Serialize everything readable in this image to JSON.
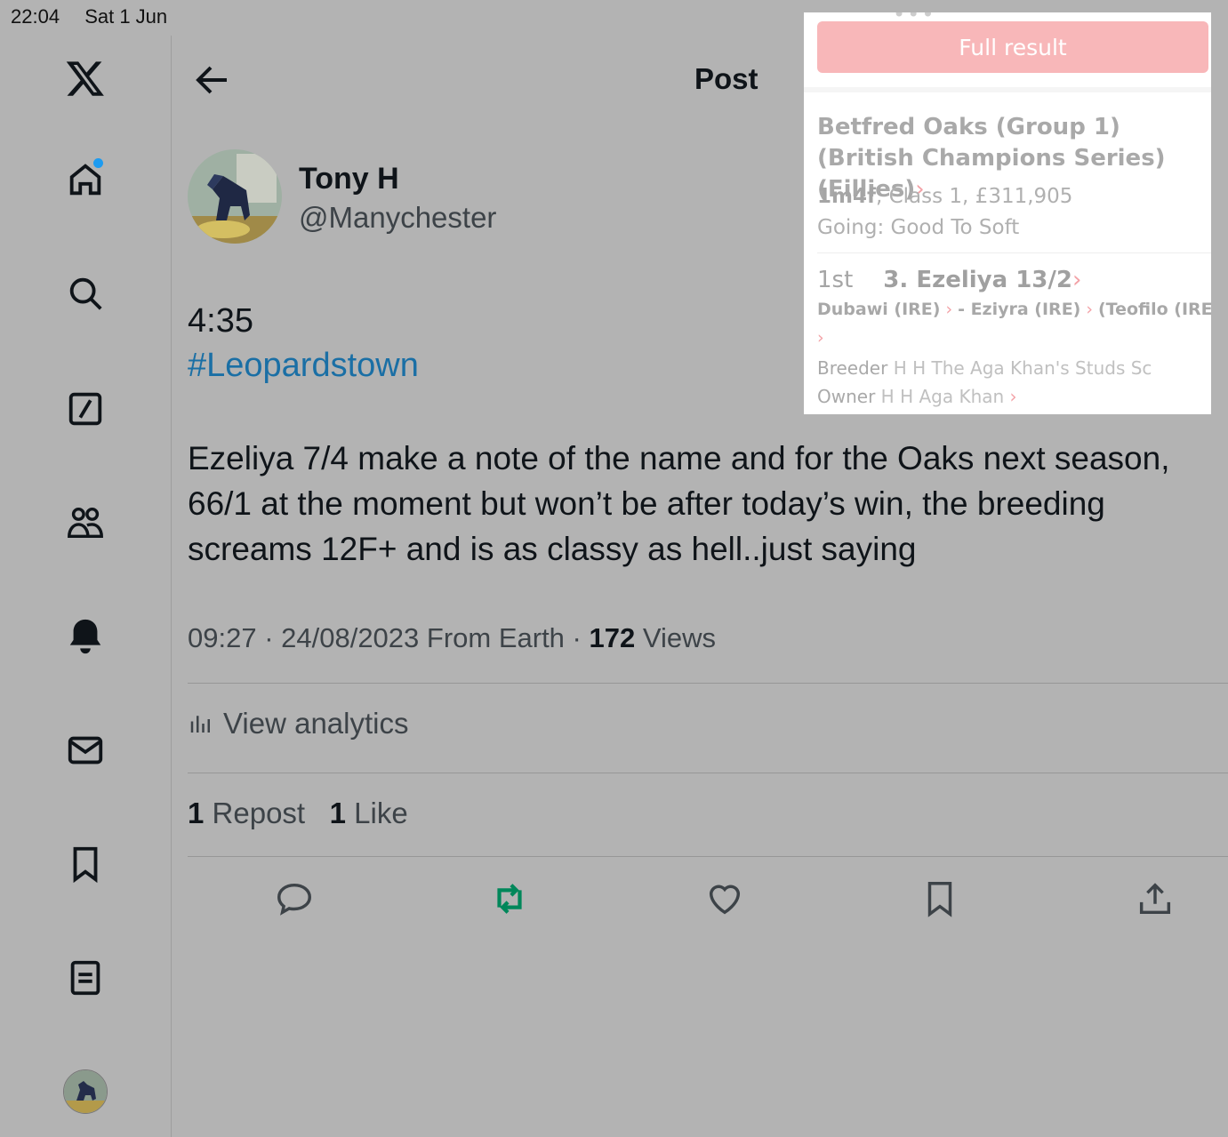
{
  "status_bar": {
    "time": "22:04",
    "date": "Sat 1 Jun"
  },
  "colors": {
    "background": "#b3b3b3",
    "link": "#1a6fa5",
    "repost_active": "#00875a",
    "popup_button": "#f8b7b9"
  },
  "rail": {
    "items": [
      "x-logo",
      "home-icon",
      "search-icon",
      "grok-icon",
      "communities-icon",
      "notifications-icon",
      "messages-icon",
      "bookmarks-icon",
      "lists-icon",
      "profile-avatar"
    ]
  },
  "header": {
    "title": "Post"
  },
  "author": {
    "name": "Tony H",
    "handle": "@Manychester"
  },
  "tweet": {
    "time_text": "4:35",
    "hashtag": "#Leopardstown",
    "body": "Ezeliya 7/4 make a note of the name and for the Oaks next season, 66/1 at the moment but won’t be after today’s win, the breeding screams 12F+ and is as classy as hell..just saying"
  },
  "meta": {
    "time": "09:27 · 24/08/2023 From Earth ·",
    "views_count": "172",
    "views_label": "Views"
  },
  "analytics": {
    "label": "View analytics"
  },
  "counts": {
    "repost_count": "1",
    "repost_label": "Repost",
    "like_count": "1",
    "like_label": "Like"
  },
  "actions": [
    "reply-icon",
    "repost-icon",
    "like-icon",
    "bookmark-icon",
    "share-icon"
  ],
  "popup": {
    "dots": "•••",
    "button": "Full result",
    "race_title": "Betfred Oaks (Group 1) (British Champions Series) (Fillies)",
    "distance": "1m4f",
    "class_prize": ", Class 1, £311,905",
    "going": "Going: Good To Soft",
    "position": "1st",
    "runner": "3. Ezeliya 13/2",
    "sire": "Dubawi (IRE)",
    "dam": "- Eziyra (IRE)",
    "dam_sire": "(Teofilo (IRE))",
    "breeder_label": "Breeder",
    "breeder": "H H The Aga Khan's Studs Sc",
    "owner_label": "Owner",
    "owner": "H H Aga Khan"
  }
}
